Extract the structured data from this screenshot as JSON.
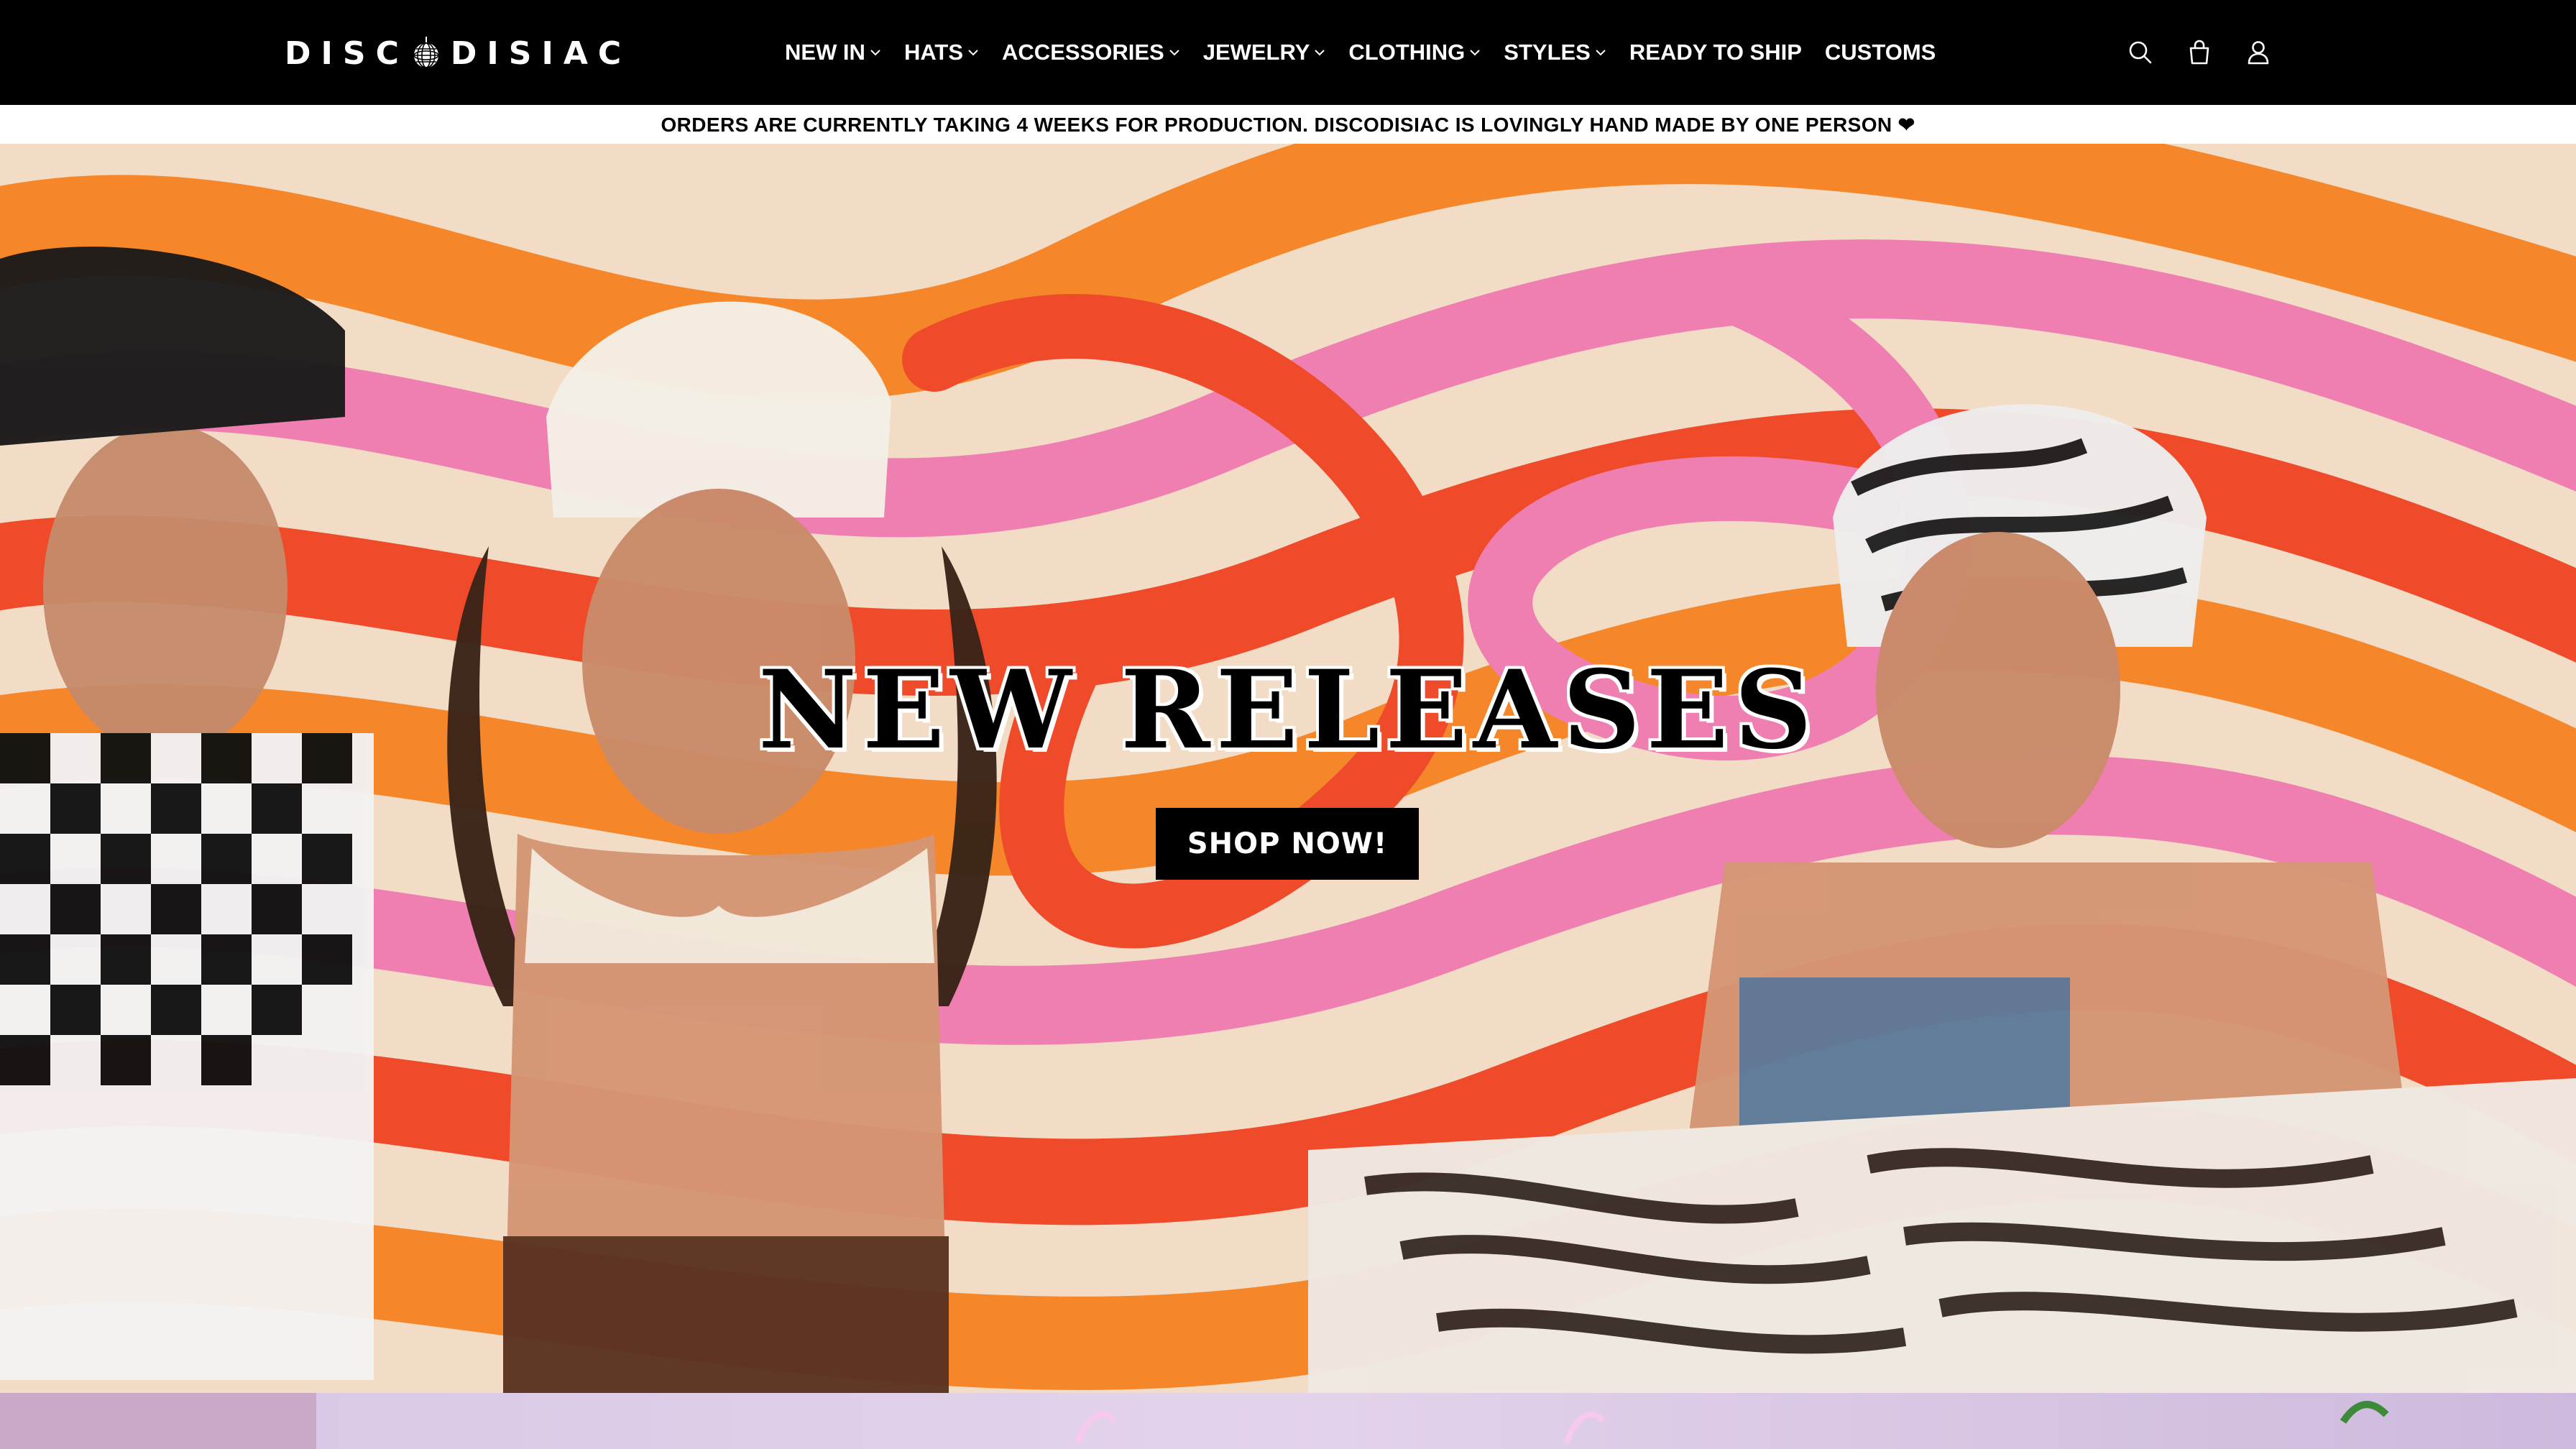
{
  "brand": {
    "logo_left": "DISC",
    "logo_right": "DISIAC"
  },
  "nav": {
    "items": [
      {
        "label": "NEW IN",
        "has_dropdown": true
      },
      {
        "label": "HATS",
        "has_dropdown": true
      },
      {
        "label": "ACCESSORIES",
        "has_dropdown": true
      },
      {
        "label": "JEWELRY",
        "has_dropdown": true
      },
      {
        "label": "CLOTHING",
        "has_dropdown": true
      },
      {
        "label": "STYLES",
        "has_dropdown": true
      },
      {
        "label": "READY TO SHIP",
        "has_dropdown": false
      },
      {
        "label": "CUSTOMS",
        "has_dropdown": false
      }
    ]
  },
  "header_icons": [
    "search-icon",
    "cart-icon",
    "account-icon"
  ],
  "announcement": {
    "text": "ORDERS ARE CURRENTLY TAKING 4 WEEKS FOR PRODUCTION. DISCODISIAC IS LOVINGLY HAND MADE BY ONE PERSON ❤"
  },
  "hero": {
    "title": "NEW RELEASES",
    "cta_label": "SHOP NOW!"
  },
  "colors": {
    "header_bg": "#000000",
    "swirl_orange": "#f5862a",
    "swirl_red": "#ef4a2a",
    "swirl_pink": "#ee7fb0",
    "swirl_cream": "#f3dcc6",
    "next_section_bg": "#d7c6e4"
  }
}
